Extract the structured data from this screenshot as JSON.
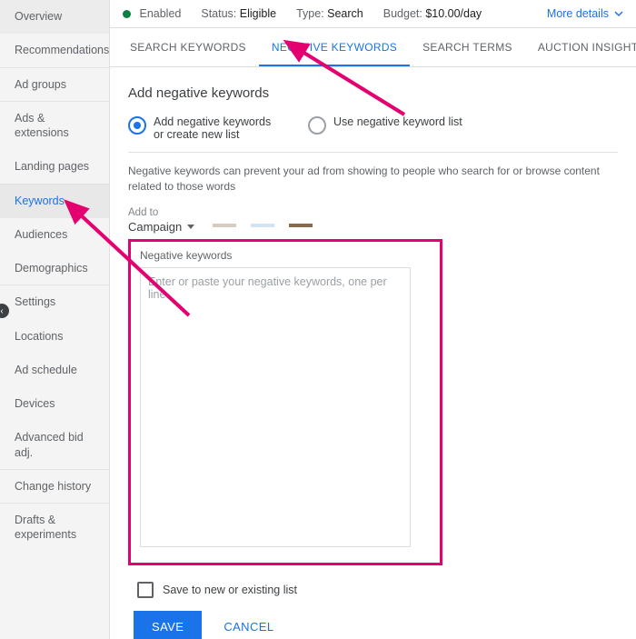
{
  "sidebar": {
    "items": [
      {
        "label": "Overview"
      },
      {
        "label": "Recommendations"
      },
      {
        "label": "Ad groups"
      },
      {
        "label": "Ads & extensions"
      },
      {
        "label": "Landing pages"
      },
      {
        "label": "Keywords"
      },
      {
        "label": "Audiences"
      },
      {
        "label": "Demographics"
      },
      {
        "label": "Settings"
      },
      {
        "label": "Locations"
      },
      {
        "label": "Ad schedule"
      },
      {
        "label": "Devices"
      },
      {
        "label": "Advanced bid adj."
      },
      {
        "label": "Change history"
      },
      {
        "label": "Drafts & experiments"
      }
    ],
    "active_index": 5
  },
  "topbar": {
    "enabled_label": "Enabled",
    "status_key": "Status:",
    "status_val": "Eligible",
    "type_key": "Type:",
    "type_val": "Search",
    "budget_key": "Budget:",
    "budget_val": "$10.00/day",
    "more_details": "More details"
  },
  "tabs": {
    "items": [
      {
        "label": "SEARCH KEYWORDS"
      },
      {
        "label": "NEGATIVE KEYWORDS"
      },
      {
        "label": "SEARCH TERMS"
      },
      {
        "label": "AUCTION INSIGHTS"
      }
    ],
    "active_index": 1
  },
  "section": {
    "title": "Add negative keywords",
    "radio": {
      "opt1": "Add negative keywords or create new list",
      "opt2": "Use negative keyword list"
    },
    "help": "Negative keywords can prevent your ad from showing to people who search for or browse content related to those words",
    "addto_label": "Add to",
    "addto_value": "Campaign",
    "card_label": "Negative keywords",
    "textarea_placeholder": "Enter or paste your negative keywords, one per line",
    "save_list_label": "Save to new or existing list"
  },
  "actions": {
    "save": "SAVE",
    "cancel": "CANCEL"
  }
}
